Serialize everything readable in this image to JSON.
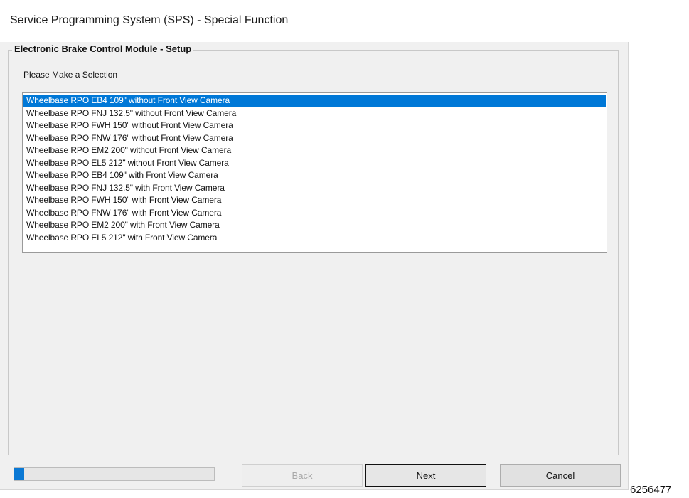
{
  "window": {
    "title": "Service Programming System (SPS) - Special Function"
  },
  "group": {
    "title": "Electronic Brake Control Module - Setup",
    "prompt": "Please Make a Selection"
  },
  "list": {
    "selected_index": 0,
    "items": [
      "Wheelbase RPO EB4 109\" without Front View Camera",
      "Wheelbase RPO FNJ 132.5\" without Front View Camera",
      "Wheelbase RPO FWH 150\" without Front View Camera",
      "Wheelbase RPO FNW 176\" without Front View Camera",
      "Wheelbase RPO EM2 200\" without Front View Camera",
      "Wheelbase RPO EL5 212\" without Front View Camera",
      "Wheelbase RPO EB4 109\" with Front View Camera",
      "Wheelbase RPO FNJ 132.5\" with Front View Camera",
      "Wheelbase RPO FWH 150\" with Front View Camera",
      "Wheelbase RPO FNW 176\" with Front View Camera",
      "Wheelbase RPO EM2 200\" with Front View Camera",
      "Wheelbase RPO EL5 212\" with Front View Camera"
    ]
  },
  "progress": {
    "fraction": 0.05,
    "color": "#0a78d4"
  },
  "buttons": {
    "back_label": "Back",
    "next_label": "Next",
    "cancel_label": "Cancel"
  },
  "footer": {
    "code": "6256477"
  },
  "colors": {
    "selection": "#0078d7"
  }
}
